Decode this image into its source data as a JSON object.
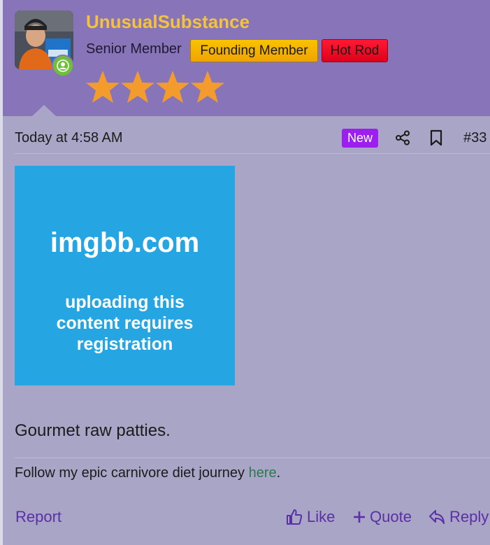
{
  "colors": {
    "header_bg": "#8874b8",
    "page_bg": "#a8a5c7",
    "username": "#f5c33b",
    "founding_badge": "#f8c300",
    "hotrod_badge": "#ff1a33",
    "new_badge": "#9c1ff0",
    "link": "#2d7a4a",
    "action": "#5b2fa6",
    "star": "#f39b2c",
    "image_bg": "#25a6e2"
  },
  "user": {
    "name": "UnusualSubstance",
    "title": "Senior Member",
    "badges": [
      "Founding Member",
      "Hot Rod"
    ],
    "star_count": 4,
    "online_icon": "user-online-icon"
  },
  "post": {
    "timestamp": "Today at 4:58 AM",
    "new_label": "New",
    "number": "#33",
    "image": {
      "domain": "imgbb.com",
      "message": "uploading this content requires registration"
    },
    "text": "Gourmet raw patties.",
    "signature": {
      "prefix": "Follow my epic carnivore diet journey ",
      "link": "here",
      "suffix": "."
    }
  },
  "actions": {
    "report": "Report",
    "like": "Like",
    "quote": "Quote",
    "reply": "Reply"
  },
  "icons": {
    "share": "share-icon",
    "bookmark": "bookmark-icon",
    "like": "thumbs-up-icon",
    "quote": "plus-icon",
    "reply": "reply-arrow-icon",
    "star": "star-icon"
  }
}
